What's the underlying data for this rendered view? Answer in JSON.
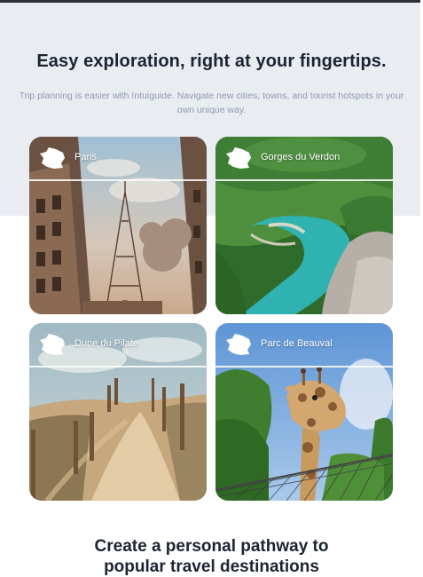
{
  "hero": {
    "title": "Easy exploration, right at your fingertips.",
    "subtitle": "Trip planning is easier with Intuiguide. Navigate new cities, towns, and tourist hotspots in your own unique way."
  },
  "destinations": [
    {
      "name": "Paris",
      "flag_icon": "france-map-icon"
    },
    {
      "name": "Gorges du Verdon",
      "flag_icon": "france-map-icon"
    },
    {
      "name": "Dune du Pilate",
      "flag_icon": "france-map-icon"
    },
    {
      "name": "Parc de Beauval",
      "flag_icon": "france-map-icon"
    }
  ],
  "section2": {
    "title_line1": "Create a personal pathway to",
    "title_line2": "popular travel destinations"
  },
  "colors": {
    "hero_background": "#e9ecf1",
    "heading_text": "#1c2331",
    "subtitle_text": "#8e9bb0"
  }
}
